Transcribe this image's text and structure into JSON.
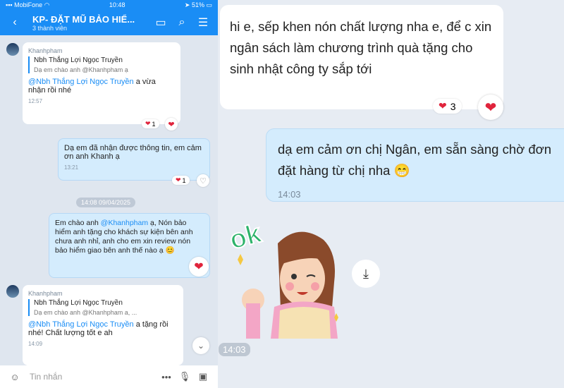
{
  "status": {
    "carrier": "MobiFone",
    "time": "10:48",
    "battery": "51%"
  },
  "header": {
    "title": "KP- ĐẶT MŨ BẢO HIỂ...",
    "subtitle": "3 thành viên"
  },
  "messages": [
    {
      "sender": "Khanhpham",
      "quote_name": "Nbh Thắng Lợi Ngọc Truyền",
      "quote_text": "Dạ em chào anh @Khanhpham ạ",
      "mention": "@Nbh Thắng Lợi Ngọc Truyền",
      "text": " a vừa nhận rồi nhé",
      "time": "12:57",
      "react_count": "1"
    },
    {
      "text": "Dạ em đã nhận được thông tin, em cảm ơn anh Khanh ạ",
      "time": "13:21",
      "react_count": "1"
    },
    {
      "date": "14:08 09/04/2025"
    },
    {
      "text_pre": "Em chào anh ",
      "mention": "@Khanhpham",
      "text_post": " ạ, Nón bảo hiểm anh tặng cho khách sự kiện bên anh chưa anh nhỉ, anh cho em xin review nón bảo hiểm giao bên anh thế nào ạ 😊"
    },
    {
      "sender": "Khanhpham",
      "quote_name": "Nbh Thắng Lợi Ngọc Truyền",
      "quote_text": "Dạ em chào anh @Khanhpham a, ...",
      "mention": "@Nbh Thắng Lợi Ngọc Truyền",
      "text": " a tặng rồi nhé! Chất lượng tốt e ah",
      "time": "14:09"
    }
  ],
  "input": {
    "placeholder": "Tin nhắn"
  },
  "right": {
    "msg1": "hi e, sếp khen nón chất lượng nha e, để c xin ngân sách làm chương trình quà tặng cho sinh nhật công ty sắp tới",
    "msg1_react_count": "3",
    "msg2": "dạ em cảm ơn chị Ngân, em sẵn sàng chờ đơn đặt hàng từ chị nha 😁",
    "msg2_time": "14:03",
    "sticker_text": "ok",
    "sticker_time": "14:03"
  },
  "colors": {
    "brand": "#1a8df5",
    "heart": "#e0243c",
    "mine_bubble": "#d4ecfd"
  }
}
